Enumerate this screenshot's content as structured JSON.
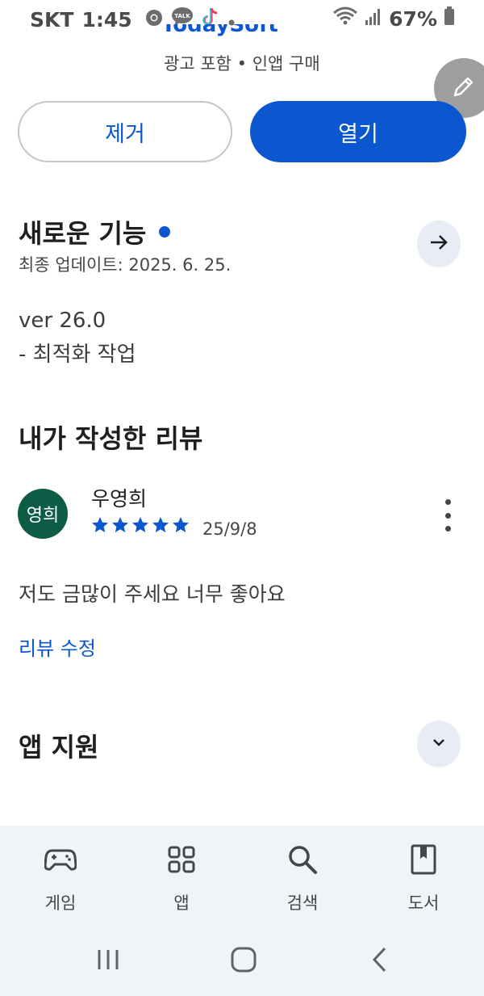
{
  "status_bar": {
    "carrier": "SKT",
    "time": "1:45",
    "battery": "67%"
  },
  "header": {
    "app_name": "TodaySoft",
    "meta": "광고 포함 • 인앱 구매"
  },
  "actions": {
    "remove_label": "제거",
    "open_label": "열기"
  },
  "whats_new": {
    "title": "새로운 기능",
    "updated": "최종 업데이트: 2025. 6. 25.",
    "notes_line1": "ver 26.0",
    "notes_line2": "- 최적화 작업"
  },
  "my_review": {
    "title": "내가 작성한 리뷰",
    "avatar_text": "영희",
    "reviewer_name": "우영희",
    "rating": 5,
    "date": "25/9/8",
    "text": "저도 금많이 주세요 너무 좋아요",
    "edit_label": "리뷰 수정"
  },
  "app_support": {
    "title": "앱 지원"
  },
  "bottom_nav": {
    "items": [
      {
        "label": "게임",
        "icon": "gamepad-icon"
      },
      {
        "label": "앱",
        "icon": "apps-grid-icon"
      },
      {
        "label": "검색",
        "icon": "search-icon"
      },
      {
        "label": "도서",
        "icon": "book-icon"
      }
    ]
  },
  "colors": {
    "accent": "#0b57d0",
    "avatar_bg": "#0d5c46",
    "nav_bg": "#f0f4f9"
  }
}
